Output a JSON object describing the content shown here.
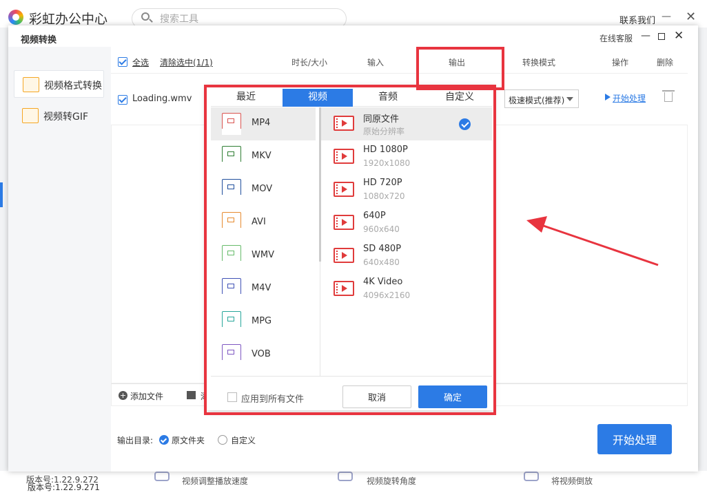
{
  "app": {
    "title": "彩虹办公中心",
    "search_placeholder": "搜索工具",
    "contact": "联系我们",
    "version": "版本号:1.22.9.271"
  },
  "bottom_tools": [
    "视频调整播放速度",
    "视频旋转角度",
    "将视频倒放"
  ],
  "dialog": {
    "title": "视频转换",
    "service": "在线客服",
    "sidebar": [
      {
        "label": "视频格式转换",
        "icon": "video-convert-icon"
      },
      {
        "label": "视频转GIF",
        "icon": "gif-icon"
      }
    ],
    "version": "版本号:1.22.9.272",
    "header": {
      "select_all": "全选",
      "clear_selection": "清除选中(1/1)",
      "duration": "时长/大小",
      "input": "输入",
      "output": "输出",
      "mode": "转换模式",
      "action": "操作",
      "delete": "删除"
    },
    "file": {
      "name": "Loading.wmv",
      "mode": "极速模式(推荐)",
      "start": "开始处理"
    },
    "add_file": "添加文件",
    "add_folder": "添",
    "output_dir_label": "输出目录:",
    "output_options": [
      "原文件夹",
      "自定义"
    ],
    "start_button": "开始处理"
  },
  "popup": {
    "tabs": [
      "最近",
      "视频",
      "音频",
      "自定义"
    ],
    "active_tab": "视频",
    "formats": [
      {
        "label": "MP4",
        "color": "#d9534f"
      },
      {
        "label": "MKV",
        "color": "#2e7d32"
      },
      {
        "label": "MOV",
        "color": "#1f4e9c"
      },
      {
        "label": "AVI",
        "color": "#e68a2e"
      },
      {
        "label": "WMV",
        "color": "#66bb6a"
      },
      {
        "label": "M4V",
        "color": "#3f51b5"
      },
      {
        "label": "MPG",
        "color": "#26a69a"
      },
      {
        "label": "VOB",
        "color": "#7e57c2"
      }
    ],
    "resolutions": [
      {
        "name": "同原文件",
        "sub": "原始分辨率"
      },
      {
        "name": "HD 1080P",
        "sub": "1920x1080"
      },
      {
        "name": "HD 720P",
        "sub": "1080x720"
      },
      {
        "name": "640P",
        "sub": "960x640"
      },
      {
        "name": "SD 480P",
        "sub": "640x480"
      },
      {
        "name": "4K Video",
        "sub": "4096x2160"
      }
    ],
    "apply_all": "应用到所有文件",
    "cancel": "取消",
    "ok": "确定"
  }
}
